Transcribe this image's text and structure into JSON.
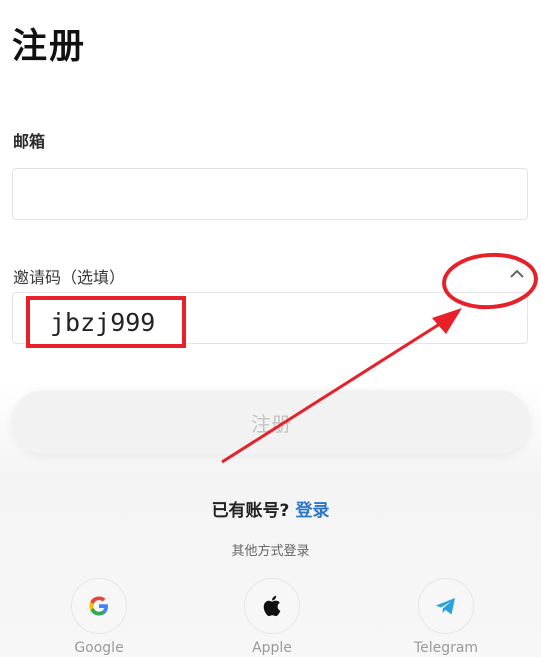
{
  "header": {
    "title": "注册"
  },
  "form": {
    "email_label": "邮箱",
    "email_value": "",
    "invite_label": "邀请码（选填）",
    "invite_value": "jbzj999",
    "submit_label": "注册"
  },
  "footer": {
    "have_account": "已有账号?",
    "login_link": "登录",
    "other_methods": "其他方式登录",
    "providers": [
      {
        "name": "Google",
        "icon": "google-icon"
      },
      {
        "name": "Apple",
        "icon": "apple-icon"
      },
      {
        "name": "Telegram",
        "icon": "telegram-icon"
      }
    ]
  },
  "colors": {
    "annotation": "#e8202a",
    "link": "#2a77c9",
    "telegram": "#2aa1da"
  }
}
